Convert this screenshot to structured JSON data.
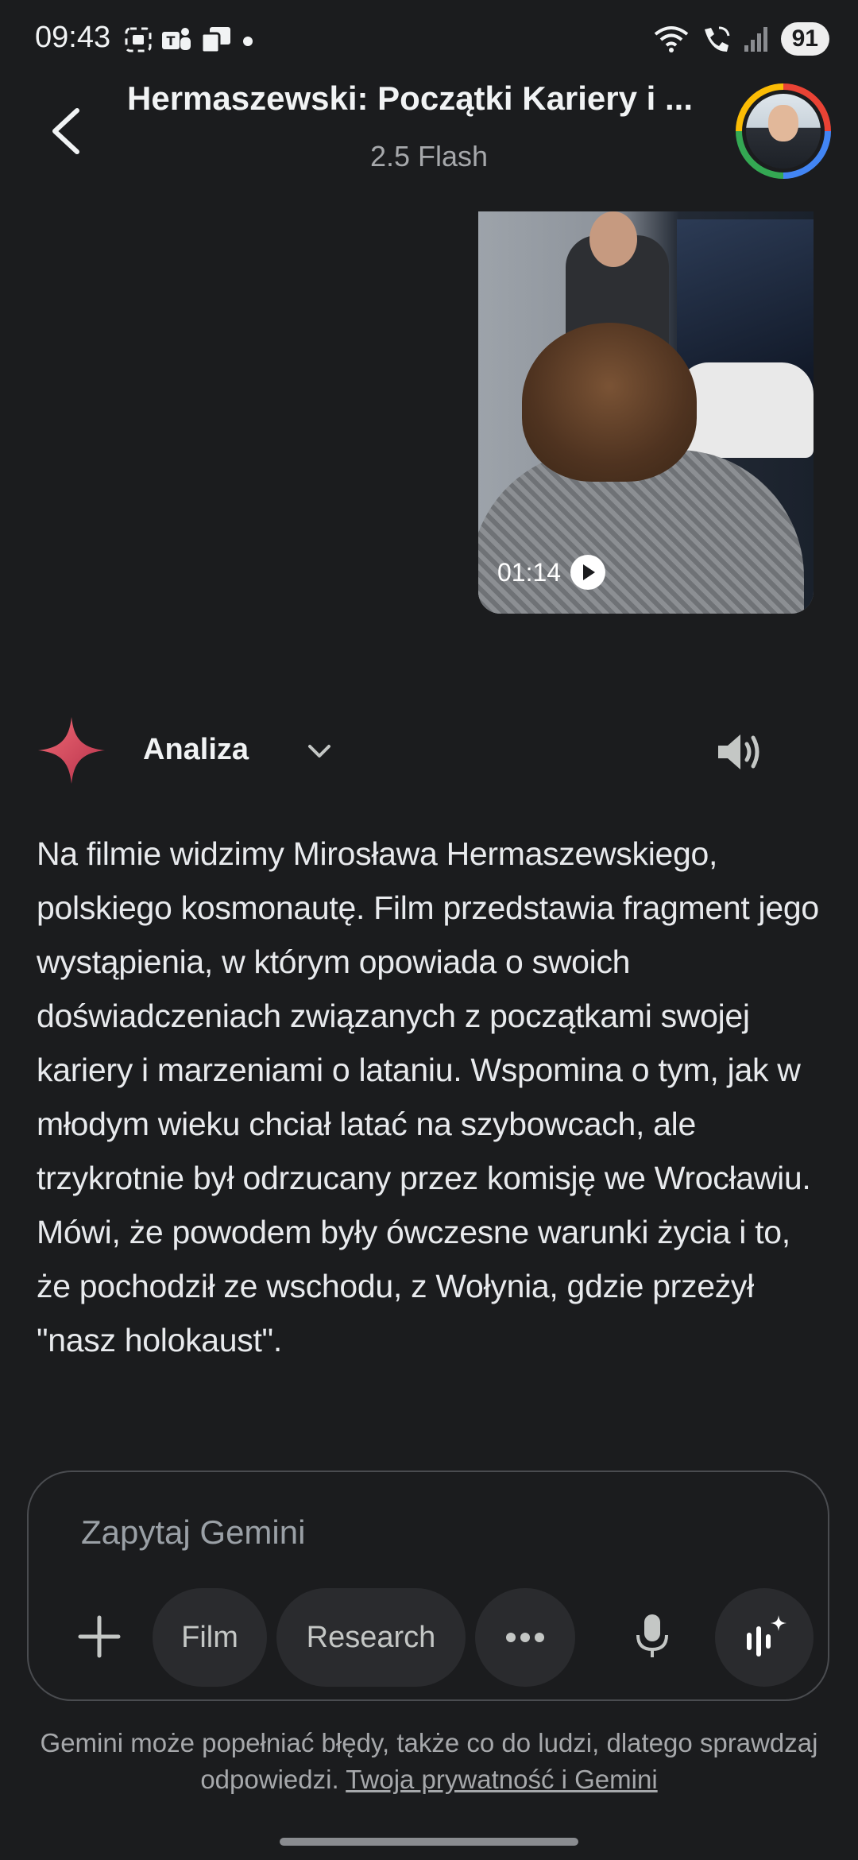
{
  "status_bar": {
    "time": "09:43",
    "battery": "91",
    "left_icons": [
      "screenshot-icon",
      "teams-icon",
      "copy-icon",
      "dot-icon"
    ],
    "right_icons": [
      "wifi-icon",
      "wifi-call-icon",
      "signal-icon"
    ]
  },
  "header": {
    "title": "Hermaszewski: Początki Kariery i ...",
    "subtitle": "2.5 Flash"
  },
  "video": {
    "duration": "01:14"
  },
  "response": {
    "model_label": "Analiza",
    "text": "Na filmie widzimy Mirosława Hermaszewskiego, polskiego kosmonautę. Film przedstawia fragment jego wystąpienia, w którym opowiada o swoich doświadczeniach związanych z początkami swojej kariery i marzeniami o lataniu. Wspomina o tym, jak w młodym wieku chciał latać na szybowcach, ale trzykrotnie był odrzucany przez komisję we Wrocławiu. Mówi, że powodem były ówczesne warunki życia i to, że pochodził ze wschodu, z Wołynia, gdzie przeżył \"nasz holokaust\"."
  },
  "input": {
    "placeholder": "Zapytaj Gemini",
    "chips": {
      "film": "Film",
      "research": "Research"
    }
  },
  "disclaimer": {
    "text": "Gemini może popełniać błędy, także co do ludzi, dlatego sprawdzaj odpowiedzi. ",
    "link": "Twoja prywatność i Gemini"
  },
  "colors": {
    "background": "#1b1c1e",
    "chip_bg": "#2a2b2e",
    "spark_start": "#f06a75",
    "spark_end": "#b5304a"
  }
}
